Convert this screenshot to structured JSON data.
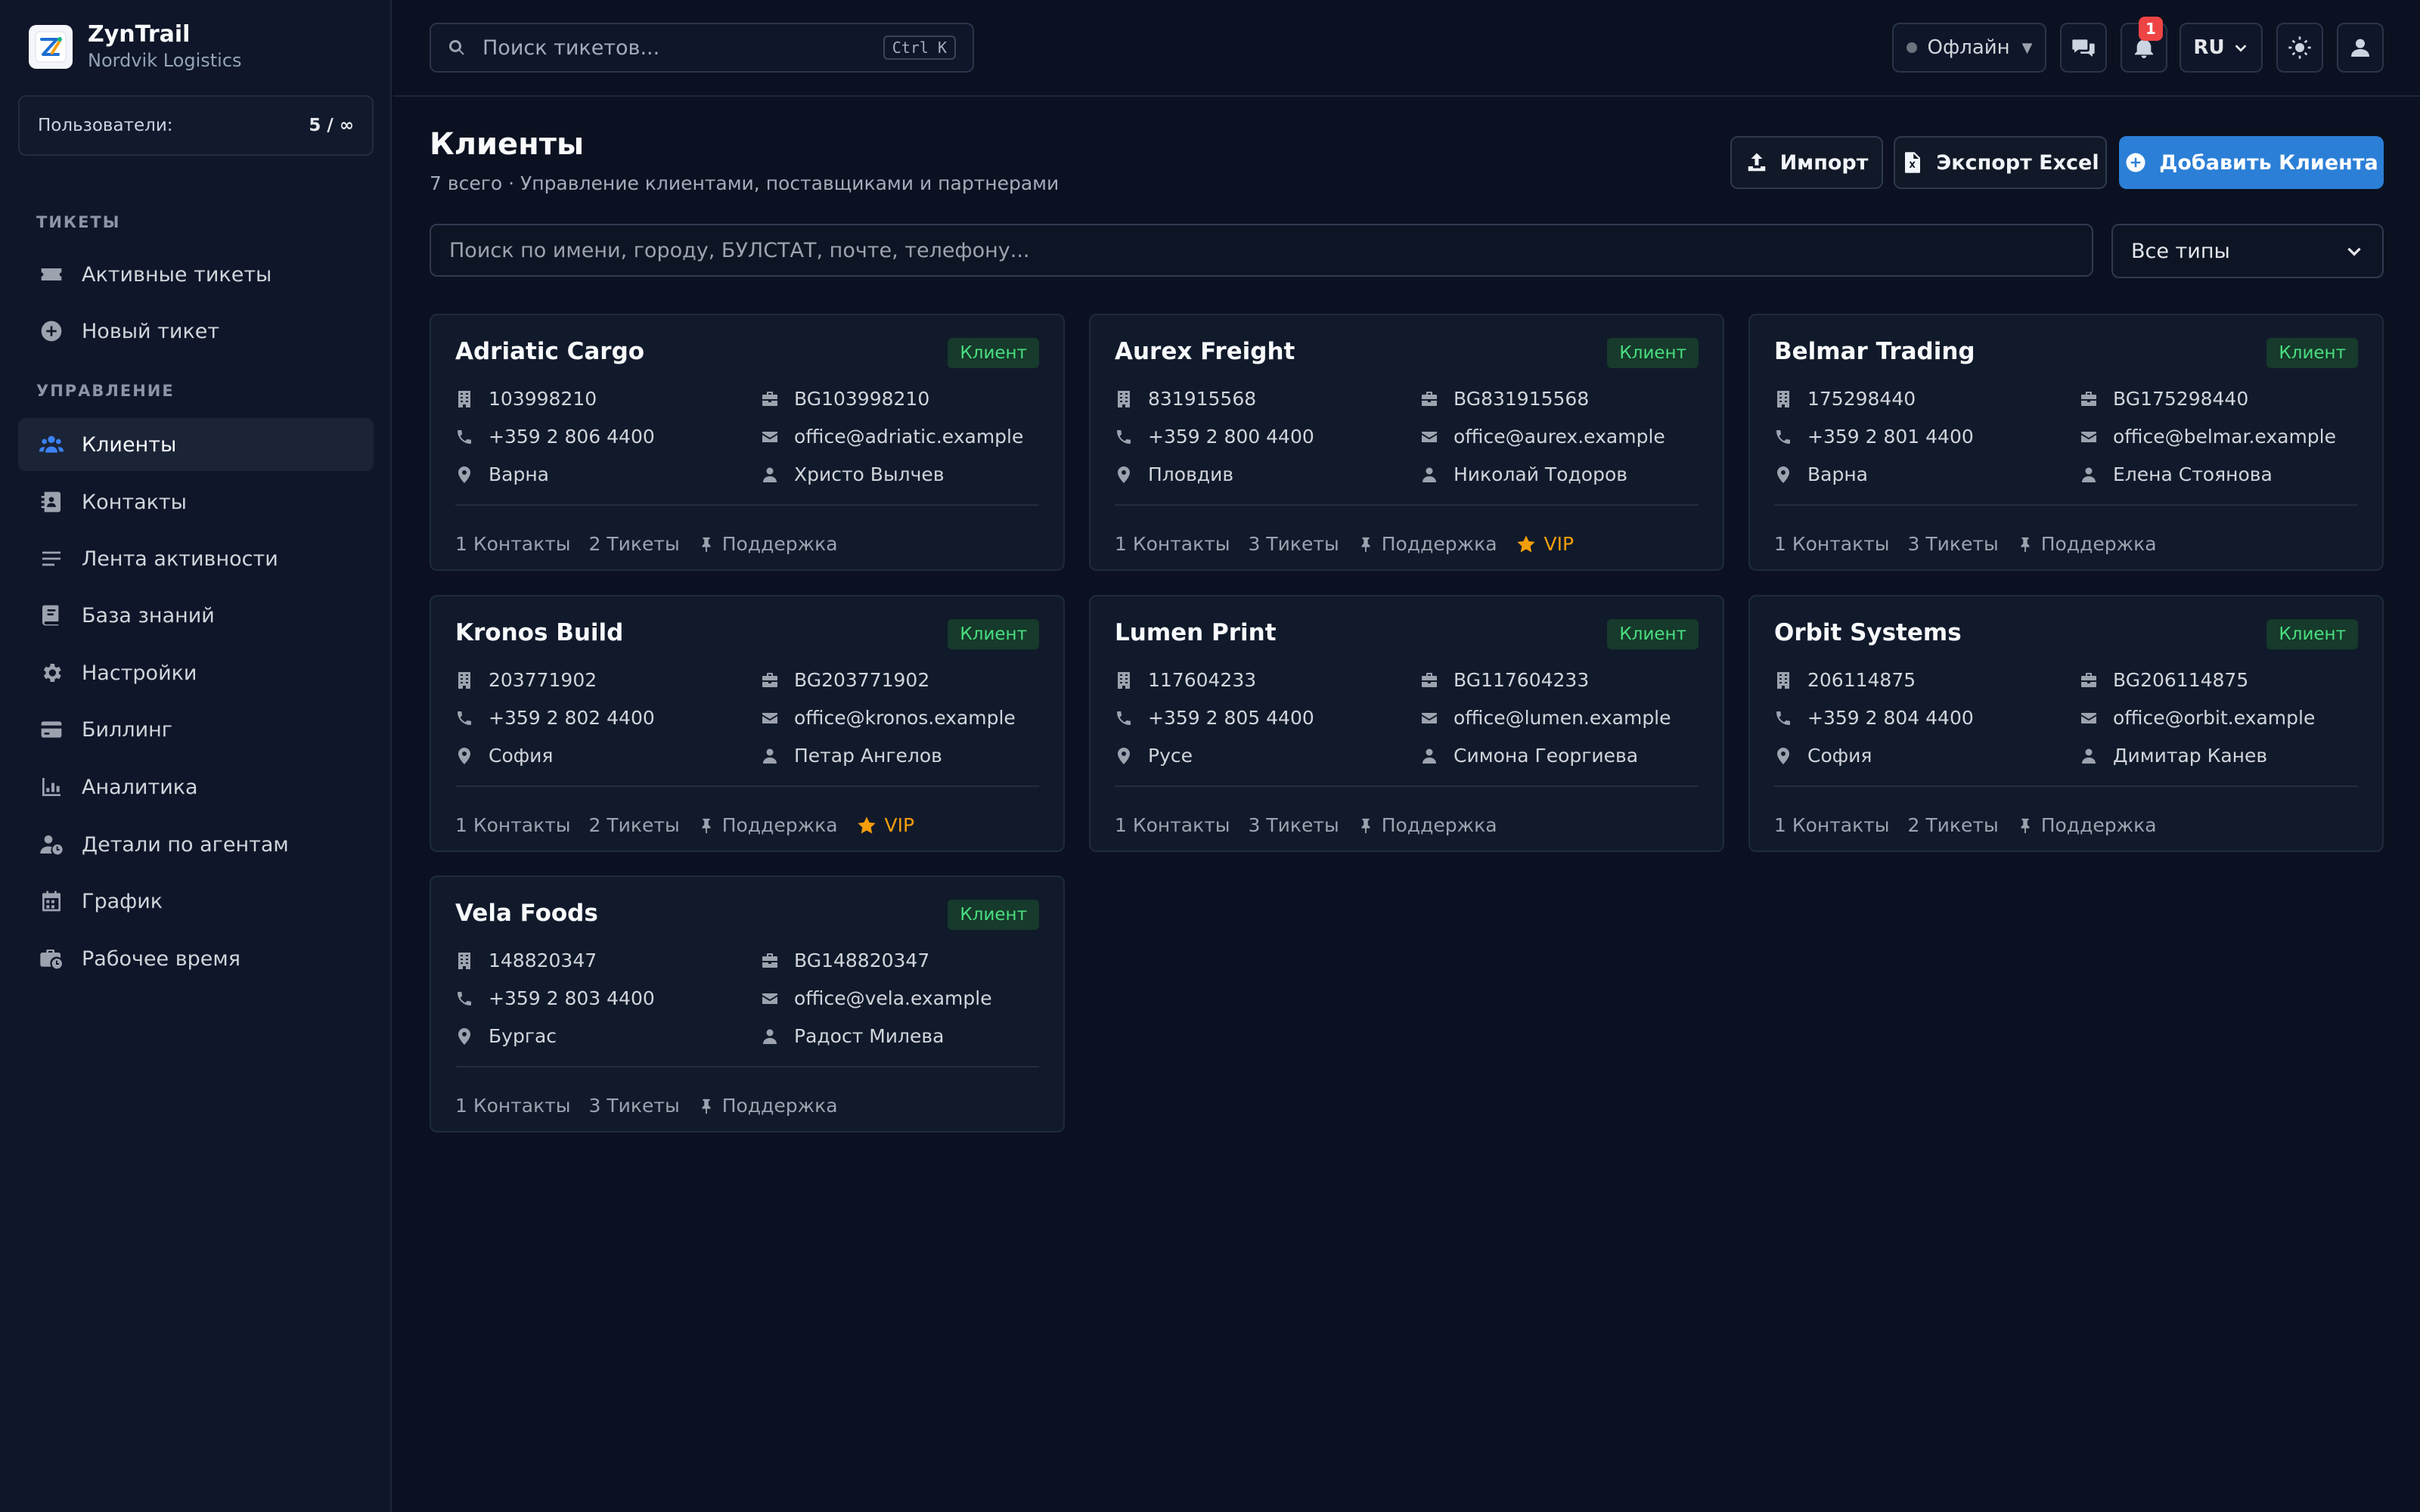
{
  "app": {
    "name": "ZynTrail",
    "org": "Nordvik Logistics"
  },
  "sidebar": {
    "users_label": "Пользователи:",
    "users_value": "5 / ∞",
    "section_tickets": "ТИКЕТЫ",
    "section_manage": "УПРАВЛЕНИЕ",
    "items": [
      {
        "label": "Активные тикеты",
        "icon": "ticket-icon"
      },
      {
        "label": "Новый тикет",
        "icon": "plus-circle-icon"
      },
      {
        "label": "Клиенты",
        "icon": "users-icon",
        "active": true
      },
      {
        "label": "Контакты",
        "icon": "address-book-icon"
      },
      {
        "label": "Лента активности",
        "icon": "list-icon"
      },
      {
        "label": "База знаний",
        "icon": "book-icon"
      },
      {
        "label": "Настройки",
        "icon": "gear-icon"
      },
      {
        "label": "Биллинг",
        "icon": "credit-card-icon"
      },
      {
        "label": "Аналитика",
        "icon": "chart-icon"
      },
      {
        "label": "Детали по агентам",
        "icon": "user-clock-icon"
      },
      {
        "label": "График",
        "icon": "calendar-icon"
      },
      {
        "label": "Рабочее время",
        "icon": "briefcase-clock-icon"
      }
    ]
  },
  "header": {
    "search_placeholder": "Поиск тикетов...",
    "search_shortcut": "Ctrl K",
    "status": "Офлайн",
    "notifications_count": "1",
    "language": "RU"
  },
  "main": {
    "title": "Клиенты",
    "subtitle": "7 всего · Управление клиентами, поставщиками и партнерами",
    "import_label": "Импорт",
    "export_label": "Экспорт Excel",
    "add_label": "Добавить Клиента",
    "search_placeholder": "Поиск по имени, городу, БУЛСТАТ, почте, телефону...",
    "type_filter": "Все типы"
  },
  "clients": [
    {
      "name": "Adriatic Cargo",
      "type": "Клиент",
      "bulstat": "103998210",
      "vat": "BG103998210",
      "phone": "+359 2 806 4400",
      "email": "office@adriatic.example",
      "city": "Варна",
      "person": "Христо Вылчев",
      "contacts": "1 Контакты",
      "tickets": "2 Тикеты",
      "plan": "Поддержка",
      "vip": ""
    },
    {
      "name": "Aurex Freight",
      "type": "Клиент",
      "bulstat": "831915568",
      "vat": "BG831915568",
      "phone": "+359 2 800 4400",
      "email": "office@aurex.example",
      "city": "Пловдив",
      "person": "Николай Тодоров",
      "contacts": "1 Контакты",
      "tickets": "3 Тикеты",
      "plan": "Поддержка",
      "vip": "VIP"
    },
    {
      "name": "Belmar Trading",
      "type": "Клиент",
      "bulstat": "175298440",
      "vat": "BG175298440",
      "phone": "+359 2 801 4400",
      "email": "office@belmar.example",
      "city": "Варна",
      "person": "Елена Стоянова",
      "contacts": "1 Контакты",
      "tickets": "3 Тикеты",
      "plan": "Поддержка",
      "vip": ""
    },
    {
      "name": "Kronos Build",
      "type": "Клиент",
      "bulstat": "203771902",
      "vat": "BG203771902",
      "phone": "+359 2 802 4400",
      "email": "office@kronos.example",
      "city": "София",
      "person": "Петар Ангелов",
      "contacts": "1 Контакты",
      "tickets": "2 Тикеты",
      "plan": "Поддержка",
      "vip": "VIP"
    },
    {
      "name": "Lumen Print",
      "type": "Клиент",
      "bulstat": "117604233",
      "vat": "BG117604233",
      "phone": "+359 2 805 4400",
      "email": "office@lumen.example",
      "city": "Русе",
      "person": "Симона Георгиева",
      "contacts": "1 Контакты",
      "tickets": "3 Тикеты",
      "plan": "Поддержка",
      "vip": ""
    },
    {
      "name": "Orbit Systems",
      "type": "Клиент",
      "bulstat": "206114875",
      "vat": "BG206114875",
      "phone": "+359 2 804 4400",
      "email": "office@orbit.example",
      "city": "София",
      "person": "Димитар Канев",
      "contacts": "1 Контакты",
      "tickets": "2 Тикеты",
      "plan": "Поддержка",
      "vip": ""
    },
    {
      "name": "Vela Foods",
      "type": "Клиент",
      "bulstat": "148820347",
      "vat": "BG148820347",
      "phone": "+359 2 803 4400",
      "email": "office@vela.example",
      "city": "Бургас",
      "person": "Радост Милева",
      "contacts": "1 Контакты",
      "tickets": "3 Тикеты",
      "plan": "Поддержка",
      "vip": ""
    }
  ]
}
